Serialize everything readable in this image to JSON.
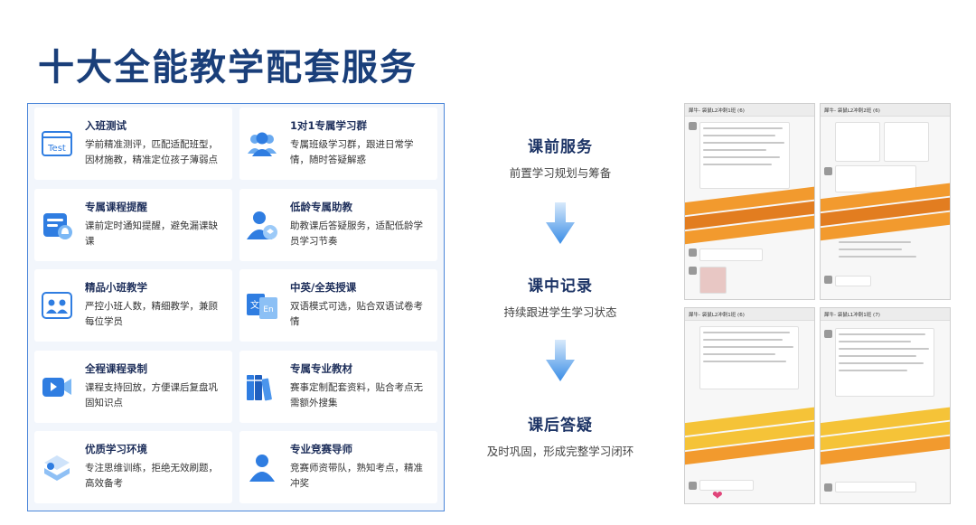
{
  "page_title": "十大全能教学配套服务",
  "services": [
    {
      "title": "入班测试",
      "desc": "学前精准测评，匹配适配班型，因材施教，精准定位孩子薄弱点",
      "icon": "test-screen-icon",
      "icon_text": "Test"
    },
    {
      "title": "1对1专属学习群",
      "desc": "专属班级学习群，跟进日常学情，随时答疑解惑",
      "icon": "group-people-icon"
    },
    {
      "title": "专属课程提醒",
      "desc": "课前定时通知提醒，避免漏课缺课",
      "icon": "bell-reminder-icon"
    },
    {
      "title": "低龄专属助教",
      "desc": "助教课后答疑服务，适配低龄学员学习节奏",
      "icon": "assistant-user-icon"
    },
    {
      "title": "精品小班教学",
      "desc": "严控小班人数，精细教学，兼顾每位学员",
      "icon": "small-class-icon"
    },
    {
      "title": "中英/全英授课",
      "desc": "双语模式可选，贴合双语试卷考情",
      "icon": "bilingual-icon",
      "icon_text_a": "文",
      "icon_text_b": "En"
    },
    {
      "title": "全程课程录制",
      "desc": "课程支持回放，方便课后复盘巩固知识点",
      "icon": "video-record-icon"
    },
    {
      "title": "专属专业教材",
      "desc": "赛事定制配套资料，贴合考点无需额外搜集",
      "icon": "books-icon"
    },
    {
      "title": "优质学习环境",
      "desc": "专注思维训练，拒绝无效刷题，高效备考",
      "icon": "environment-icon"
    },
    {
      "title": "专业竞赛导师",
      "desc": "竞赛师资带队，熟知考点，精准冲奖",
      "icon": "mentor-user-icon"
    }
  ],
  "stages": [
    {
      "title": "课前服务",
      "desc": "前置学习规划与筹备"
    },
    {
      "title": "课中记录",
      "desc": "持续跟进学生学习状态"
    },
    {
      "title": "课后答疑",
      "desc": "及时巩固，形成完整学习闭环"
    }
  ],
  "screenshots": [
    {
      "header": "犀牛-            袋鼠L2冲刺1班 (6)"
    },
    {
      "header": "犀牛-            袋鼠L2冲刺2班 (6)"
    },
    {
      "header": "犀牛-            袋鼠L2冲刺1班 (6)"
    },
    {
      "header": "犀牛-            袋鼠L1冲刺1班 (7)"
    }
  ],
  "colors": {
    "title": "#1a3f7a",
    "frame_border": "#4a86d9",
    "frame_bg": "#f2f6fc",
    "icon_blue": "#2f7de1",
    "arrow_blue": "#3a8de6",
    "band_orange": "#f29a2e",
    "band_yellow": "#f5c338"
  }
}
